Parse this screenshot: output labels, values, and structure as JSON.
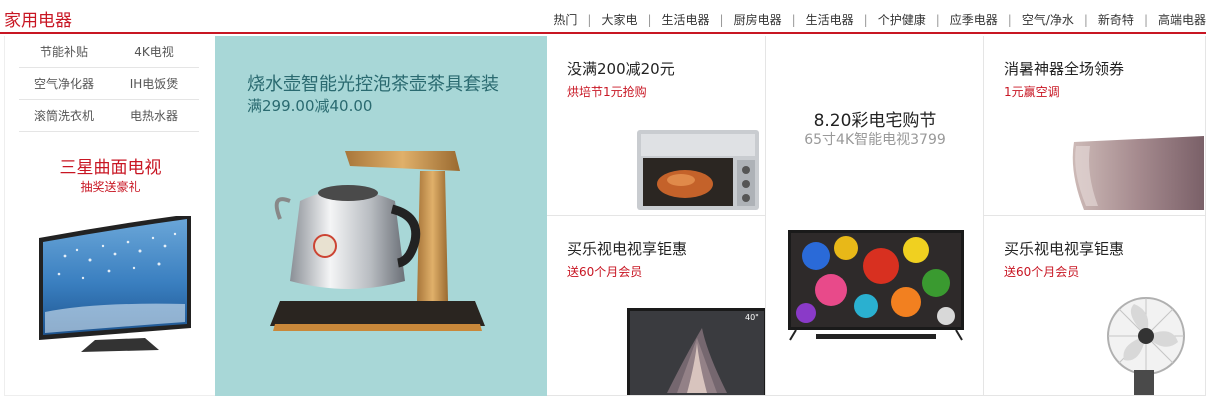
{
  "header": {
    "title": "家用电器",
    "tabs": [
      "热门",
      "大家电",
      "生活电器",
      "厨房电器",
      "生活电器",
      "个护健康",
      "应季电器",
      "空气/净水",
      "新奇特",
      "高端电器"
    ]
  },
  "left": {
    "links": [
      [
        "节能补贴",
        "4K电视"
      ],
      [
        "空气净化器",
        "IH电饭煲"
      ],
      [
        "滚筒洗衣机",
        "电热水器"
      ]
    ],
    "promo_title": "三星曲面电视",
    "promo_sub": "抽奖送豪礼"
  },
  "featured": {
    "title": "烧水壶智能光控泡茶壶茶具套装",
    "subtitle": "满299.00减40.00"
  },
  "grid": {
    "c1": {
      "title": "没满200减20元",
      "sub": "烘培节1元抢购"
    },
    "c2": {
      "title": "买乐视电视享钜惠",
      "sub": "送60个月会员"
    },
    "c3": {
      "title": "8.20彩电宅购节",
      "sub": "65寸4K智能电视3799"
    },
    "c4": {
      "title": "消暑神器全场领券",
      "sub": "1元赢空调"
    },
    "c5": {
      "title": "买乐视电视享钜惠",
      "sub": "送60个月会员"
    }
  },
  "colors": {
    "accent": "#c81623",
    "featured_bg": "#a8d7d7",
    "featured_text": "#2a6a70"
  }
}
